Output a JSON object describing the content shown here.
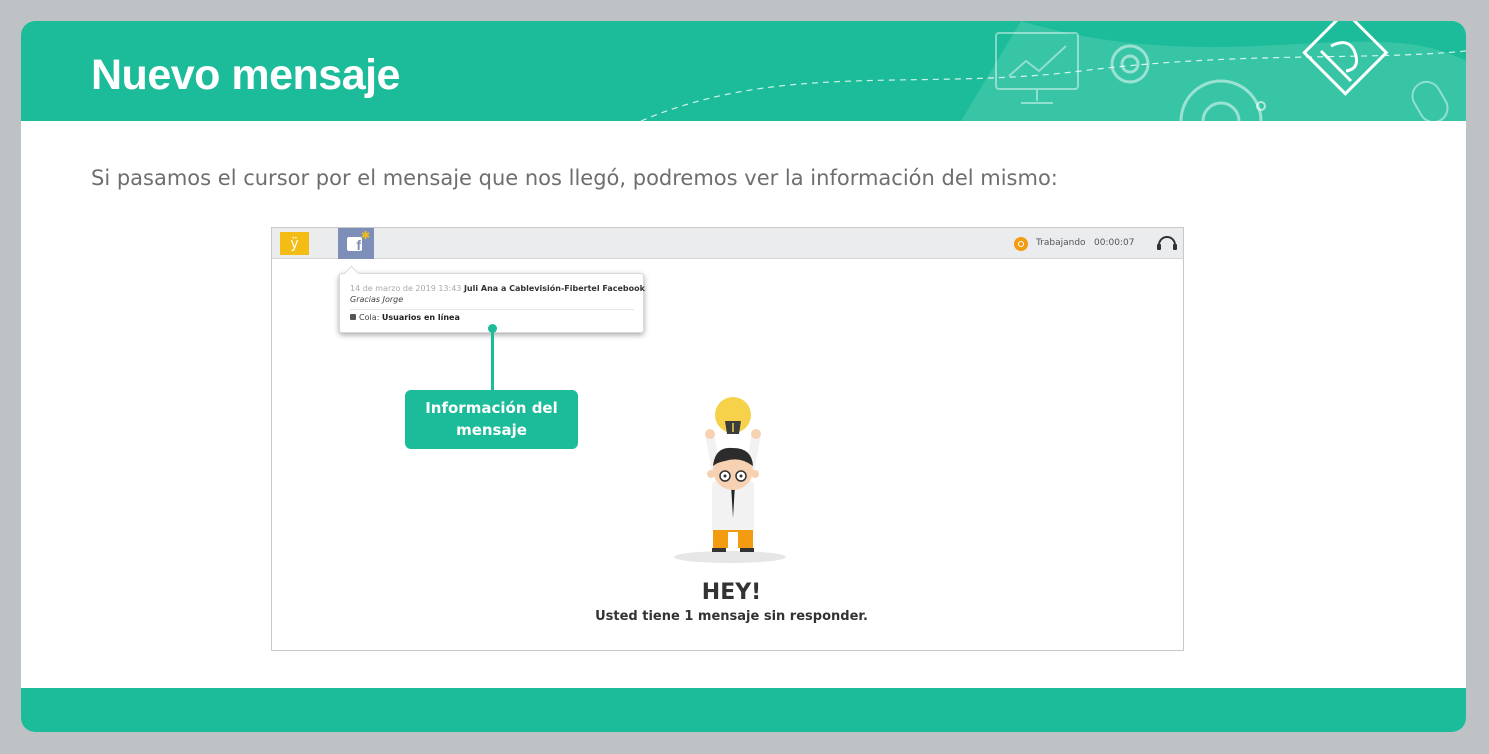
{
  "header": {
    "title": "Nuevo mensaje",
    "color": "#1cbb99"
  },
  "intro_text": "Si pasamos el cursor por el mensaje que nos llegó, podremos ver la información del mismo:",
  "screenshot": {
    "topbar": {
      "app_logo": "ÿ",
      "status": "Trabajando",
      "timer": "00:00:07"
    },
    "tooltip": {
      "date": "14 de marzo de 2019 13:43",
      "sender": "Juli Ana a Cablevisión-Fibertel Facebook",
      "message": "Gracias Jorge",
      "queue_label": "Cola:",
      "queue_value": "Usuarios en línea"
    },
    "callout": {
      "line1": "Información del",
      "line2": "mensaje"
    },
    "empty_state": {
      "title": "HEY!",
      "subtitle": "Usted tiene 1 mensaje sin responder."
    }
  },
  "colors": {
    "accent": "#1cbb99",
    "facebook_tab": "#7d8fb8",
    "logo": "#f3bd16",
    "status": "#f39c12"
  },
  "icons": [
    "facebook-icon",
    "status-icon",
    "headset-icon",
    "queue-icon",
    "lightbulb-icon",
    "gear-icon",
    "monitor-icon",
    "puzzle-icon"
  ]
}
